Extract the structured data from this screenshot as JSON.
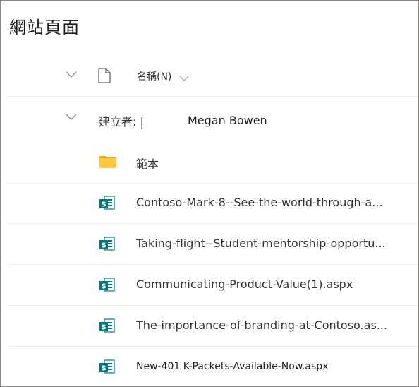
{
  "page": {
    "title": "網站頁面"
  },
  "header": {
    "name_column": "名稱(N)"
  },
  "group": {
    "label": "建立者: |",
    "name": "Megan Bowen"
  },
  "folder": {
    "name": "範本",
    "icon": "folder-icon"
  },
  "files": [
    {
      "name": "Contoso-Mark-8--See-the-world-through-a...",
      "icon": "sharepoint-page-icon"
    },
    {
      "name": "Taking-flight--Student-mentorship-opportu...",
      "icon": "sharepoint-page-icon"
    },
    {
      "name": "Communicating-Product-Value(1).aspx",
      "icon": "sharepoint-page-icon"
    },
    {
      "name": "The-importance-of-branding-at-Contoso.as...",
      "icon": "sharepoint-page-icon"
    },
    {
      "name": "New-401 K-Packets-Available-Now.aspx",
      "icon": "sharepoint-page-icon"
    }
  ],
  "colors": {
    "sharepoint_teal": "#03787C",
    "folder_yellow": "#FFB900"
  }
}
